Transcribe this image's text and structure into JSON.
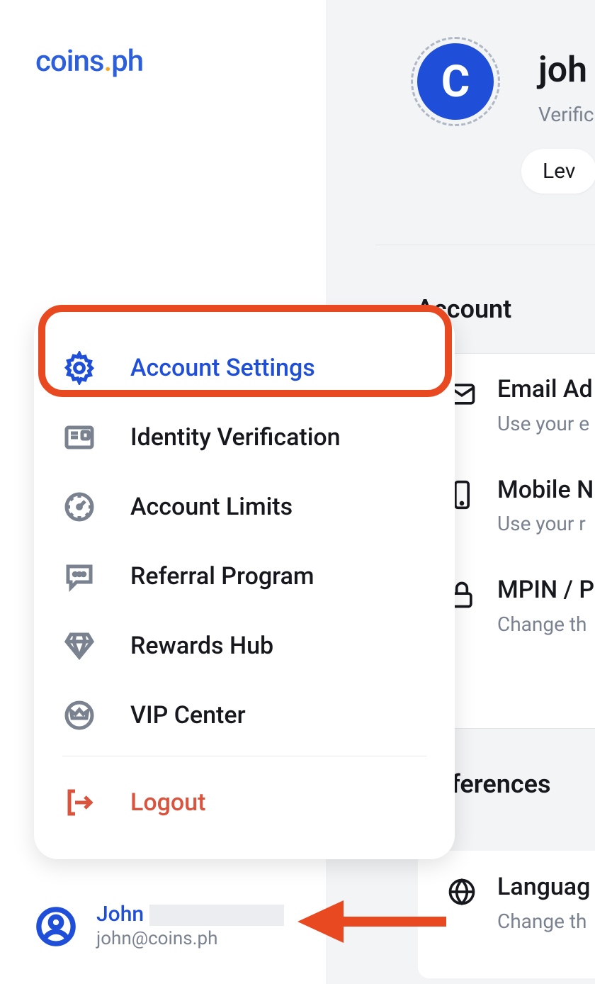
{
  "logo": {
    "text1": "coins",
    "text2": ".ph"
  },
  "profile": {
    "avatar_letter": "C",
    "username": "joh",
    "verification_label": "Verifica",
    "level_chip": "Lev"
  },
  "sections": {
    "account": "Account",
    "preferences": "references"
  },
  "settings_items": [
    {
      "key": "email",
      "label": "Email Ad",
      "sub": "Use your e"
    },
    {
      "key": "mobile",
      "label": "Mobile N",
      "sub": "Use your r"
    },
    {
      "key": "mpin",
      "label": "MPIN / Pa",
      "sub": "Change th"
    }
  ],
  "prefs_items": [
    {
      "key": "language",
      "label": "Languag",
      "sub": "Change th"
    }
  ],
  "popup": {
    "items": [
      {
        "key": "account-settings",
        "label": "Account Settings",
        "active": true
      },
      {
        "key": "identity-verification",
        "label": "Identity Verification"
      },
      {
        "key": "account-limits",
        "label": "Account Limits"
      },
      {
        "key": "referral-program",
        "label": "Referral Program"
      },
      {
        "key": "rewards-hub",
        "label": "Rewards Hub"
      },
      {
        "key": "vip-center",
        "label": "VIP Center"
      }
    ],
    "logout": "Logout"
  },
  "user": {
    "name": "John",
    "email": "john@coins.ph"
  },
  "colors": {
    "brand": "#1f4fd8",
    "accent": "#f5a623",
    "danger": "#d9533d",
    "highlight": "#e84921"
  }
}
